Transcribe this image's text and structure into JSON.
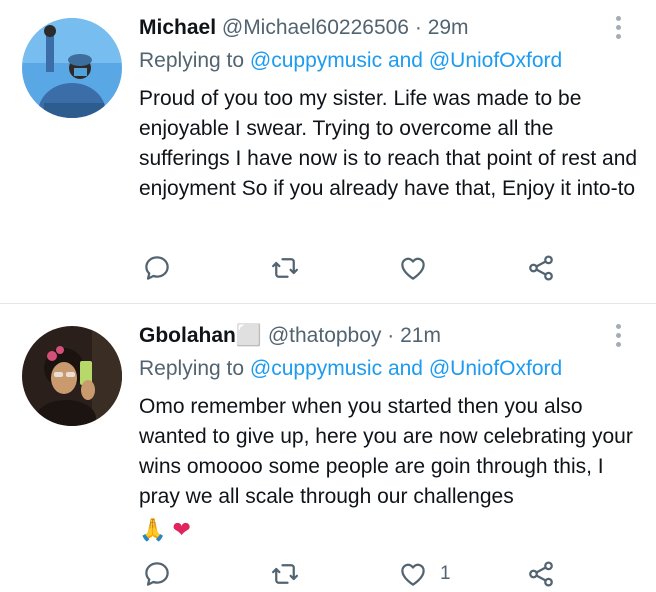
{
  "tweets": [
    {
      "name": "Michael",
      "handle": "@Michael60226506",
      "separator": "·",
      "time": "29m",
      "replying_prefix": "Replying to",
      "mention_1": "@cuppymusic",
      "and_word": "and",
      "mention_2": "@UniofOxford",
      "text": "Proud of you too my sister. Life was made to be enjoyable I swear. Trying to overcome all the sufferings I have now is to reach that point of rest and enjoyment So if you already have that, Enjoy it into-to",
      "emojis": "",
      "likes": "",
      "icons": {
        "avatar": "avatar-raised-fist-photo",
        "more": "more-vertical-icon",
        "reply": "reply-icon",
        "retweet": "retweet-icon",
        "like": "heart-icon",
        "share": "share-icon"
      }
    },
    {
      "name": "Gbolahan⬜",
      "handle": "@thatopboy",
      "separator": "·",
      "time": "21m",
      "replying_prefix": "Replying to",
      "mention_1": "@cuppymusic",
      "and_word": "and",
      "mention_2": "@UniofOxford",
      "text": "Omo remember when you started then you also wanted to give up, here you are now celebrating your wins omoooo some people are goin through this, I pray we all scale through our challenges",
      "emoji_1": "🙏",
      "emoji_2": "❤",
      "likes": "1",
      "icons": {
        "avatar": "avatar-selfie-photo",
        "more": "more-vertical-icon",
        "reply": "reply-icon",
        "retweet": "retweet-icon",
        "like": "heart-icon",
        "share": "share-icon"
      }
    }
  ],
  "colors": {
    "link": "#1d9bf0",
    "secondary_text": "#536471",
    "primary_text": "#0f1419",
    "icon": "#536471",
    "heart": "#e0245e"
  }
}
